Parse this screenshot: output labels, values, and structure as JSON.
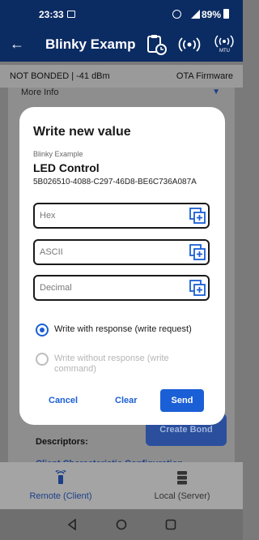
{
  "status_bar": {
    "time": "23:33",
    "battery": "89%"
  },
  "app_bar": {
    "title": "Blinky Example",
    "mtu_label": "MTU"
  },
  "info_bar": {
    "bond_status": "NOT BONDED | -41 dBm",
    "ota": "OTA Firmware"
  },
  "background": {
    "more_info": "More Info",
    "create_bond": "Create Bond",
    "descriptors": "Descriptors:",
    "client_characteristic": "Client Characteristic Configuration"
  },
  "dialog": {
    "title": "Write new value",
    "service": "Blinky Example",
    "characteristic": "LED Control",
    "uuid": "5B026510-4088-C297-46D8-BE6C736A087A",
    "fields": {
      "hex_placeholder": "Hex",
      "ascii_placeholder": "ASCII",
      "decimal_placeholder": "Decimal"
    },
    "options": {
      "with_response": "Write with response (write request)",
      "without_response": "Write without response (write command)"
    },
    "buttons": {
      "cancel": "Cancel",
      "clear": "Clear",
      "send": "Send"
    }
  },
  "bottom_nav": {
    "remote": "Remote (Client)",
    "local": "Local (Server)"
  },
  "colors": {
    "primary": "#0b2b63",
    "accent": "#1a5fd6"
  }
}
